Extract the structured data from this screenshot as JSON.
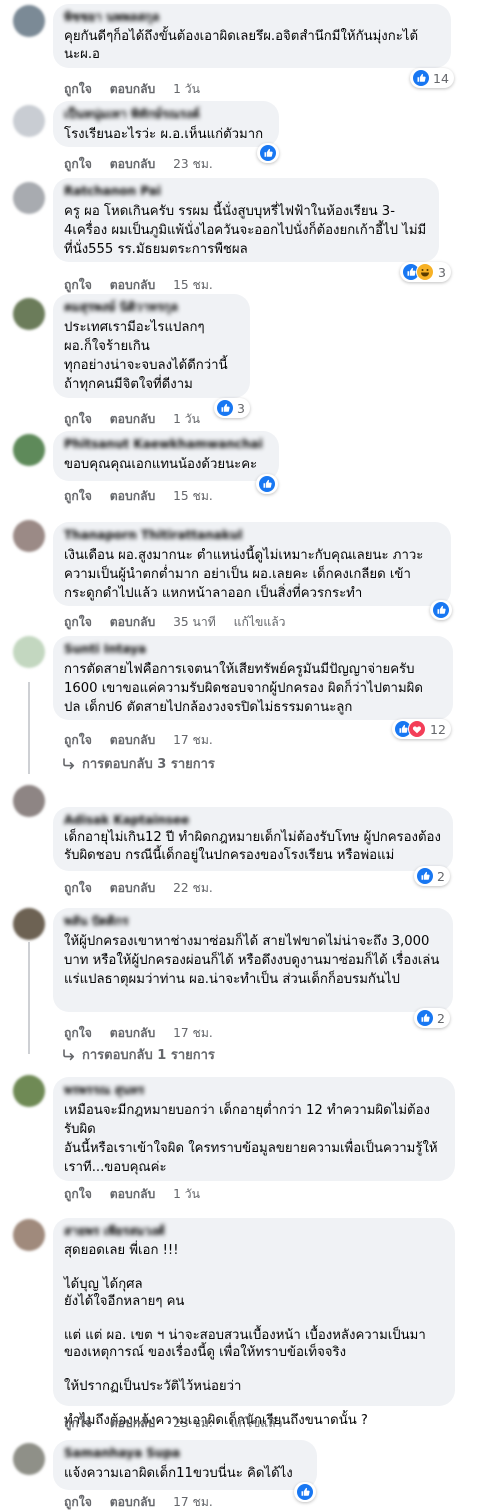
{
  "labels": {
    "like": "ถูกใจ",
    "reply": "ตอบกลับ",
    "edited": "แก้ไขแล้ว"
  },
  "colors": {
    "bubble": "#f0f2f5",
    "meta": "#65676b",
    "like": "#1877f2",
    "haha": "#f7b125",
    "love": "#f33e58"
  },
  "comments": [
    {
      "name": "พิชชยา นพพลสกุล",
      "text": "คุยกันดีๆก็อได้ถึงขั้นต้องเอาผิดเลยรึผ.อจิตสำนึกมีให้กันมุ่งกะไต้นะผ.อ",
      "time": "1 วัน",
      "reactions": [
        "like"
      ],
      "reaction_count": "14"
    },
    {
      "name": "เป็นหนุ่มเทา พิทักษ์รณรงค์",
      "text": "โรงเรียนอะไรว่ะ ผ.อ.เห็นแก่ตัวมาก",
      "time": "23 ชม.",
      "reactions": [
        "like"
      ],
      "reaction_count": ""
    },
    {
      "name": "Ratchanon Pai",
      "text": "ครู ผอ โหดเกินครับ รรผม นี้นั่งสูบบุหรี่ไฟฟ้าในห้องเรียน 3-4เครื่อง ผมเป็นภูมิแพ้นั่งไอควันจะออกไปนั่งก็ต้องยกเก้าอี้ไป ไม่มีที่นั่ง555 รร.มัธยมตระการพืชผล",
      "time": "15 ชม.",
      "reactions": [
        "like",
        "haha"
      ],
      "reaction_count": "3"
    },
    {
      "name": "คมสุรพงษ์ นิติวาทรกุล",
      "text": "ประเทศเรามีอะไรแปลกๆ\nผอ.ก็ใจร้ายเกิน\nทุกอย่างน่าจะจบลงได้ดีกว่านี้\nถ้าทุกคนมีจิตใจที่ดีงาม",
      "time": "1 วัน",
      "reactions": [
        "like"
      ],
      "reaction_count": "3"
    },
    {
      "name": "Phitsanut Kaewkhamwanchai",
      "text": "ขอบคุณคุณเอกแทนน้องด้วยนะคะ",
      "time": "15 ชม.",
      "reactions": [
        "like"
      ],
      "reaction_count": ""
    },
    {
      "name": "Thanaporn Thitirattanakul",
      "text": "เงินเดือน ผอ.สูงมากนะ ตำแหน่งนี้ดูไม่เหมาะกับคุณเลยนะ ภาวะความเป็นผู้นำตกต่ำมาก อย่าเป็น ผอ.เลยคะ เด็กคงเกลียด เข้ากระดูกดำไปแล้ว แหกหน้าลาออก เป็นสิ่งที่ควรกระทำ",
      "time": "35 นาที",
      "edited": true,
      "reactions": [
        "like"
      ],
      "reaction_count": ""
    },
    {
      "name": "Sunti Intaya",
      "text": "การตัดสายไฟคือการเจตนาให้เสียทรัพย์ครูมันมีปัญญาจ่ายครับ 1600 เขาขอแค่ความรับผิดชอบจากผู้ปกครอง ผิดก็ว่าไปตามผิด ปล เด็กป6 ตัดสายไปกล้องวงจรปิดไม่ธรรมดานะลูก",
      "time": "17 ชม.",
      "reactions": [
        "like",
        "love"
      ],
      "reaction_count": "12",
      "replies": "การตอบกลับ 3 รายการ"
    },
    {
      "name": "Adisak Kaptainsee",
      "text": "เด็กอายุไม่เกิน12 ปี ทำผิดกฎหมายเด็กไม่ต้องรับโทษ ผู้ปกครองต้องรับผิดชอบ กรณีนี้เด็กอยู่ในปกครองของโรงเรียน หรือพ่อแม่",
      "time": "22 ชม.",
      "reactions": [
        "like"
      ],
      "reaction_count": "2"
    },
    {
      "name": "พลัน ปัตติกร",
      "text": "ให้ผู้ปกครองเขาหาช่างมาซ่อมก็ได้ สายไฟขาดไม่น่าจะถึง 3,000 บาท หรือให้ผู้ปกครองผ่อนก็ได้ หรือดึงงบดูงานมาซ่อมก็ได้ เรื่องเล่นแร่แปลธาตุผมว่าท่าน ผอ.น่าจะทำเป็น ส่วนเด็กก็อบรมกันไป",
      "time": "17 ชม.",
      "reactions": [
        "like"
      ],
      "reaction_count": "2",
      "replies": "การตอบกลับ 1 รายการ"
    },
    {
      "name": "พรพรรณ สุนทร",
      "text": "เหมือนจะมีกฎหมายบอกว่า เด็กอายุต่ำกว่า 12 ทำความผิดไม่ต้องรับผิด\nอันนี้หรือเราเข้าใจผิด ใครทราบข้อมูลขยายความเพื่อเป็นความรู้ให้เราที...ขอบคุณค่ะ",
      "time": "1 วัน",
      "reactions": [],
      "reaction_count": ""
    },
    {
      "name": "สายพร เพียรสมวงศ์",
      "text": "สุดยอดเลย พี่เอก !!!\n\nได้บุญ ได้กุศล\nยังได้ใจอีกหลายๆ คน\n\nแต่ แต่ ผอ. เขต ฯ น่าจะสอบสวนเบื้องหน้า เบื้องหลังความเป็นมาของเหตุการณ์ ของเรื่องนี้ดู เพื่อให้ทราบข้อเท็จจริง\n\nให้ปรากฏเป็นประวัติไว้หน่อยว่า\n\nทำไมถึงต้องแจ้งความเอาผิดเด็กนักเรียนถึงขนาดนั้น ?",
      "time": "23 ชม.",
      "edited": true,
      "reactions": [],
      "reaction_count": ""
    },
    {
      "name": "Samanhaya Supa",
      "text": "แจ้งความเอาผิดเด็ก11ขวบนี่นะ คิดได้ไง",
      "time": "17 ชม.",
      "reactions": [
        "like"
      ],
      "reaction_count": ""
    }
  ]
}
